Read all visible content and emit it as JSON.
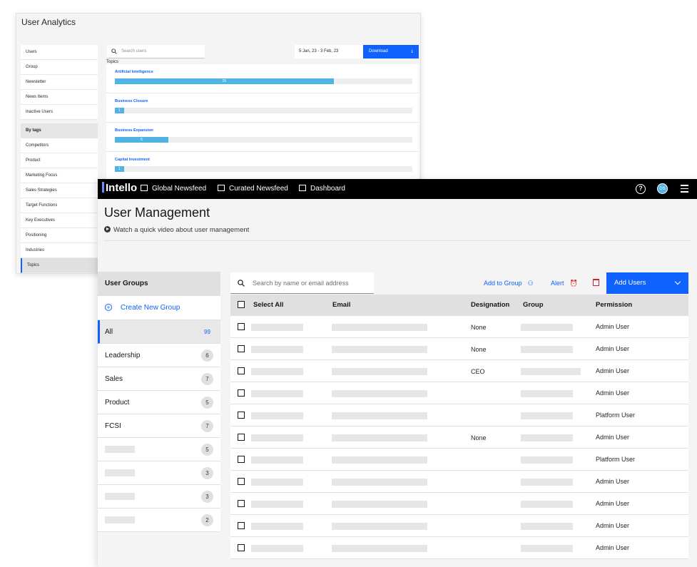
{
  "analytics": {
    "title": "User Analytics",
    "sidebar": [
      "Users",
      "Group",
      "Newsletter",
      "News Items",
      "Inactive Users"
    ],
    "tags_section": "By tags",
    "tags": [
      "Competitors",
      "Product",
      "Marketing Focus",
      "Sales Strategies",
      "Target Functions",
      "Key Executives",
      "Positioning",
      "Industries",
      "Topics"
    ],
    "active_tag": "Topics",
    "search_placeholder": "Search users",
    "date_range": "5 Jan, 23 - 3 Feb, 23",
    "download_label": "Download",
    "topics_label": "Topics",
    "topics": [
      {
        "name": "Artificial Intelligence",
        "value": 25,
        "fraction": 0.736
      },
      {
        "name": "Business Closure",
        "value": 1,
        "fraction": 0.03
      },
      {
        "name": "Business Expansion",
        "value": 6,
        "fraction": 0.18
      },
      {
        "name": "Capital Investment",
        "value": 1,
        "fraction": 0.03
      }
    ]
  },
  "app": {
    "logo": "Intello",
    "nav": [
      "Global Newsfeed",
      "Curated Newsfeed",
      "Dashboard"
    ],
    "help_icon": "question-icon",
    "avatar_initials": "DS",
    "accent": "#0f62fe"
  },
  "page": {
    "title": "User Management",
    "video_link": "Watch a quick video about user management"
  },
  "groups": {
    "header": "User Groups",
    "create_label": "Create New Group",
    "items": [
      {
        "name": "All",
        "count": "99",
        "active": true
      },
      {
        "name": "Leadership",
        "count": "6"
      },
      {
        "name": "Sales",
        "count": "7"
      },
      {
        "name": "Product",
        "count": "5"
      },
      {
        "name": "FCSI",
        "count": "7"
      },
      {
        "name": "",
        "count": "5"
      },
      {
        "name": "",
        "count": "3"
      },
      {
        "name": "",
        "count": "3"
      },
      {
        "name": "",
        "count": "2"
      }
    ]
  },
  "toolbar": {
    "search_placeholder": "Search by name or email address",
    "add_to_group": "Add to Group",
    "alert": "Alert",
    "add_users": "Add Users"
  },
  "table": {
    "columns": {
      "select_all": "Select All",
      "email": "Email",
      "designation": "Designation",
      "group": "Group",
      "permission": "Permission"
    },
    "rows": [
      {
        "designation": "None",
        "permission": "Admin User"
      },
      {
        "designation": "None",
        "permission": "Admin User"
      },
      {
        "designation": "CEO",
        "permission": "Admin User"
      },
      {
        "designation": "",
        "permission": "Admin User"
      },
      {
        "designation": "",
        "permission": "Platform User"
      },
      {
        "designation": "None",
        "permission": "Admin User"
      },
      {
        "designation": "",
        "permission": "Platform User"
      },
      {
        "designation": "",
        "permission": "Admin User"
      },
      {
        "designation": "",
        "permission": "Admin User"
      },
      {
        "designation": "",
        "permission": "Admin User"
      },
      {
        "designation": "",
        "permission": "Admin User"
      }
    ]
  }
}
